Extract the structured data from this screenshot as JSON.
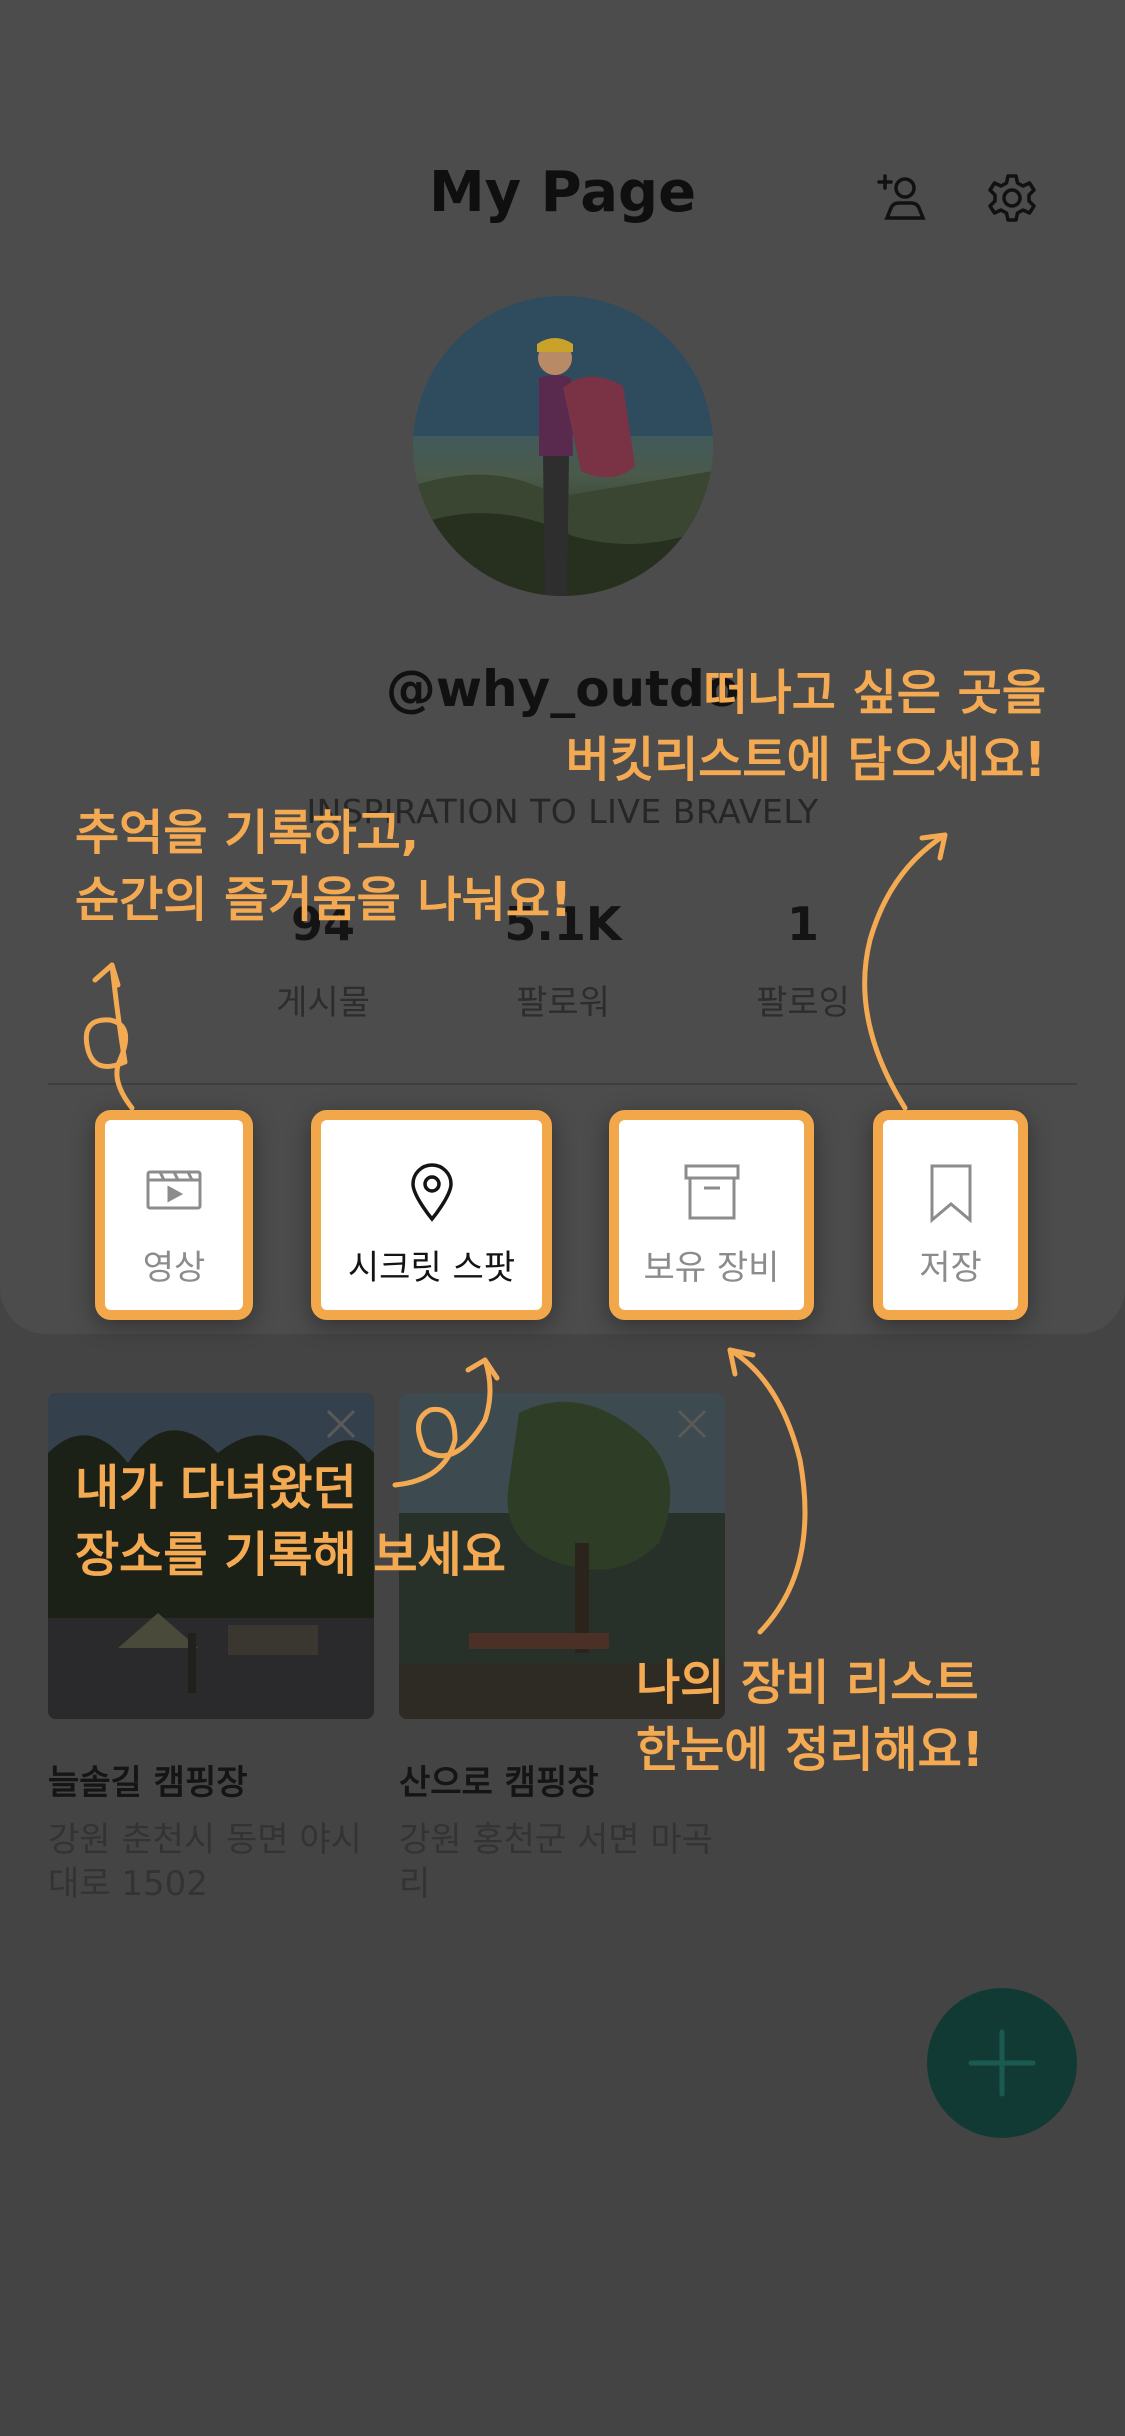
{
  "header": {
    "title": "My Page",
    "add_friend_icon": "person-add-icon",
    "settings_icon": "gear-icon"
  },
  "profile": {
    "username": "@why_outdo",
    "bio": "INSPIRATION TO LIVE BRAVELY",
    "stats": [
      {
        "value": "94",
        "label": "게시물"
      },
      {
        "value": "5.1K",
        "label": "팔로워"
      },
      {
        "value": "1",
        "label": "팔로잉"
      }
    ]
  },
  "tabs": [
    {
      "label": "영상",
      "icon": "video-clapper-icon"
    },
    {
      "label": "시크릿 스팟",
      "icon": "map-pin-icon"
    },
    {
      "label": "보유 장비",
      "icon": "archive-box-icon"
    },
    {
      "label": "저장",
      "icon": "bookmark-icon"
    }
  ],
  "spots": [
    {
      "name": "늘솔길 캠핑장",
      "address": "강원 춘천시 동면 야시대로 1502"
    },
    {
      "name": "산으로 캠핑장",
      "address": "강원 홍천군 서면 마곡리"
    }
  ],
  "callouts": {
    "top_right_line1": "떠나고 싶은 곳을",
    "top_right_line2": "버킷리스트에 담으세요!",
    "top_left_line1": "추억을 기록하고,",
    "top_left_line2": "순간의 즐거움을 나눠요!",
    "middle_line1": "내가 다녀왔던",
    "middle_line2": "장소를 기록해 보세요",
    "bottom_line1": "나의 장비 리스트",
    "bottom_line2": "한눈에 정리해요!"
  },
  "colors": {
    "overlay": "#444444",
    "accent": "#f2a84a",
    "fab": "#123a35"
  }
}
